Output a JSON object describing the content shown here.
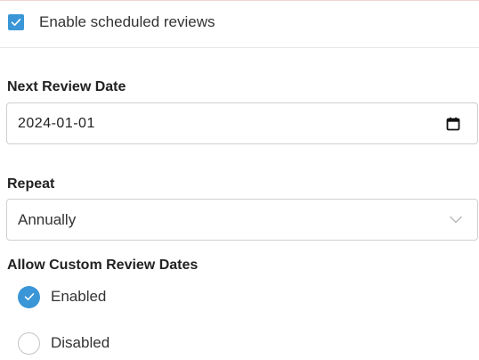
{
  "schedule": {
    "checkbox_label": "Enable scheduled reviews",
    "checked": true
  },
  "next_review": {
    "label": "Next Review Date",
    "value": "2024-01-01"
  },
  "repeat": {
    "label": "Repeat",
    "selected": "Annually"
  },
  "custom_dates": {
    "label": "Allow Custom Review Dates",
    "options": [
      {
        "label": "Enabled",
        "selected": true
      },
      {
        "label": "Disabled",
        "selected": false
      }
    ]
  },
  "colors": {
    "accent": "#3a96d6",
    "border": "#cfcfcf",
    "text": "#333333"
  }
}
